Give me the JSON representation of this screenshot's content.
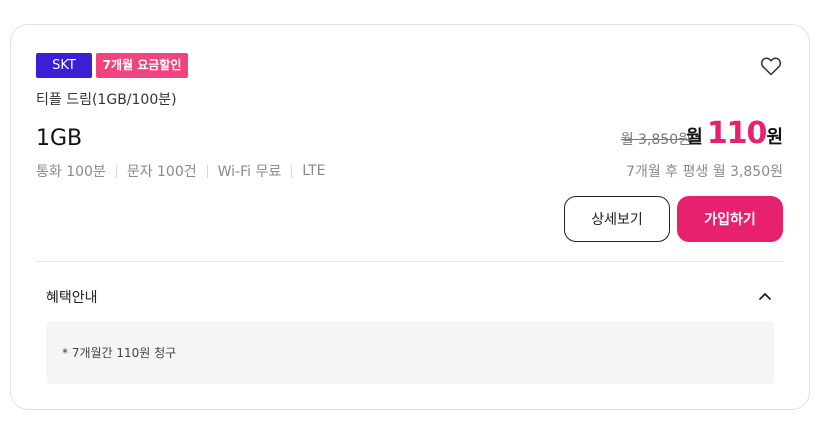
{
  "badges": {
    "carrier": "SKT",
    "promo": "7개월 요금할인"
  },
  "plan": {
    "name": "티플 드림(1GB/100분)",
    "data": "1GB"
  },
  "specs": [
    "통화 100분",
    "문자 100건",
    "Wi-Fi 무료",
    "LTE"
  ],
  "price": {
    "original": "월 3,850원",
    "prefix": "월",
    "amount": "110",
    "suffix": "원",
    "after": "7개월 후 평생 월 3,850원"
  },
  "buttons": {
    "detail": "상세보기",
    "join": "가입하기"
  },
  "benefit": {
    "title": "혜택안내",
    "text": "* 7개월간 110원 청구"
  },
  "colors": {
    "carrier_badge": "#3b1fd6",
    "promo_badge": "#f0447f",
    "accent": "#e8216e"
  },
  "icons": {
    "favorite": "heart-outline-icon",
    "toggle": "chevron-up-icon"
  }
}
